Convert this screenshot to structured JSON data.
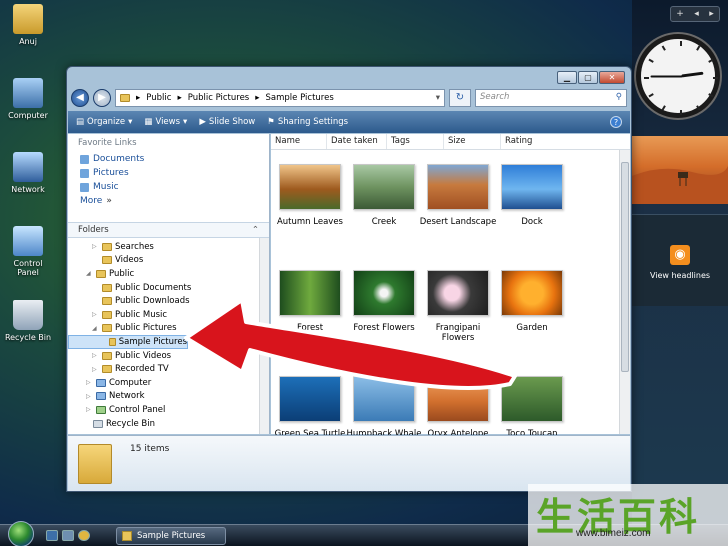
{
  "desktop": {
    "icons": [
      "Anuj",
      "Computer",
      "Network",
      "Control Panel",
      "Recycle Bin"
    ]
  },
  "sidebar_gadgets": {
    "controls": [
      "+",
      "◂",
      "▸"
    ],
    "clock": {
      "hour": 2,
      "minute": 45
    },
    "feed_label": "View headlines"
  },
  "window": {
    "title": "Sample Pictures",
    "address": {
      "segments": [
        "Public",
        "Public Pictures",
        "Sample Pictures"
      ]
    },
    "search": {
      "placeholder": "Search"
    },
    "toolbar": {
      "organize": "Organize",
      "views": "Views",
      "slideshow": "Slide Show",
      "sharing": "Sharing Settings"
    },
    "favorites": {
      "heading": "Favorite Links",
      "items": [
        "Documents",
        "Pictures",
        "Music"
      ],
      "more": "More"
    },
    "folders": {
      "heading": "Folders",
      "tree": [
        "Searches",
        "Videos",
        "Public",
        "Public Documents",
        "Public Downloads",
        "Public Music",
        "Public Pictures",
        "Sample Pictures",
        "Public Videos",
        "Recorded TV",
        "Computer",
        "Network",
        "Control Panel",
        "Recycle Bin"
      ]
    },
    "columns": [
      "Name",
      "Date taken",
      "Tags",
      "Size",
      "Rating"
    ],
    "files": [
      "Autumn Leaves",
      "Creek",
      "Desert Landscape",
      "Dock",
      "Forest",
      "Forest Flowers",
      "Frangipani Flowers",
      "Garden",
      "Green Sea Turtle",
      "Humpback Whale",
      "Oryx Antelope",
      "Toco Toucan"
    ],
    "status": {
      "count": "15 items"
    }
  },
  "taskbar": {
    "active_window": "Sample Pictures"
  },
  "watermark": {
    "chinese": "生活百科",
    "url": "www.bimeiz.com"
  },
  "colors": {
    "link": "#1a4f99",
    "toolbar": "#2d5a8c",
    "arrow": "#d8141c",
    "watermark_green": "#5aa428"
  }
}
